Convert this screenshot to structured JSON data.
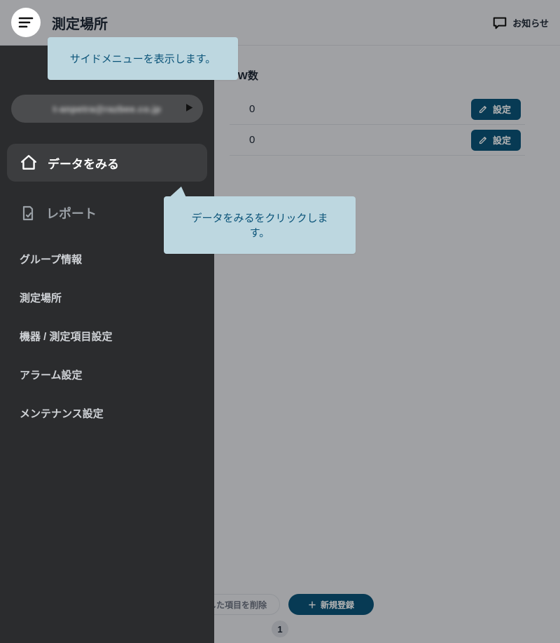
{
  "header": {
    "title": "測定場所",
    "notice_label": "お知らせ"
  },
  "callouts": {
    "menu_hint": "サイドメニューを表示します。",
    "data_hint": "データをみるをクリックします。"
  },
  "sidebar": {
    "account_text": "t-anpetra@razbee.co.jp",
    "primary": {
      "label": "データをみる"
    },
    "secondary": {
      "label": "レポート"
    },
    "links": [
      "グループ情報",
      "測定場所",
      "機器 / 測定項目設定",
      "アラーム設定",
      "メンテナンス設定"
    ]
  },
  "table": {
    "gw_header": "GW数",
    "rows": [
      {
        "value": "0",
        "action": "設定"
      },
      {
        "value": "0",
        "action": "設定"
      }
    ]
  },
  "footer": {
    "delete_label": "択した項目を削除",
    "new_label": "新規登録",
    "page": "1"
  }
}
